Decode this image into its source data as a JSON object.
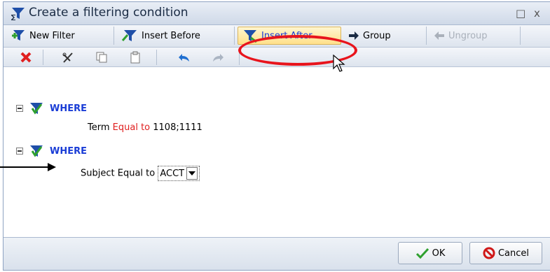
{
  "dialog": {
    "title": "Create a filtering condition",
    "controls": {
      "restore": "□",
      "close": "x"
    }
  },
  "toolbar1": {
    "new_filter": "New Filter",
    "insert_before": "Insert Before",
    "insert_after": "Insert After",
    "group": "Group",
    "ungroup": "Ungroup"
  },
  "toolbar2": {
    "icons": [
      "delete-icon",
      "cut-icon",
      "copy-icon",
      "paste-icon",
      "undo-icon",
      "redo-icon"
    ]
  },
  "tree": {
    "groups": [
      {
        "keyword": "WHERE",
        "condition": {
          "field": "Term",
          "operator": "Equal to",
          "value": "1108;1111"
        }
      },
      {
        "keyword": "WHERE",
        "condition": {
          "field": "Subject",
          "operator": "Equal to",
          "value": "ACCT"
        }
      }
    ]
  },
  "footer": {
    "ok": "OK",
    "cancel": "Cancel"
  },
  "colors": {
    "accent_blue": "#1a3dd6",
    "operator_red": "#e02020",
    "highlight_red": "#e8141c"
  }
}
